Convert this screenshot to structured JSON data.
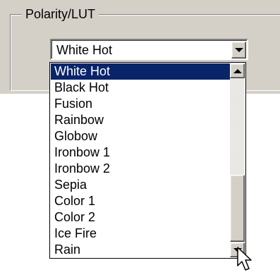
{
  "groupbox": {
    "title": "Polarity/LUT"
  },
  "combo": {
    "selected_value": "White Hot"
  },
  "dropdown": {
    "items": [
      {
        "label": "White Hot",
        "selected": true
      },
      {
        "label": "Black Hot",
        "selected": false
      },
      {
        "label": "Fusion",
        "selected": false
      },
      {
        "label": "Rainbow",
        "selected": false
      },
      {
        "label": "Globow",
        "selected": false
      },
      {
        "label": "Ironbow 1",
        "selected": false
      },
      {
        "label": "Ironbow 2",
        "selected": false
      },
      {
        "label": "Sepia",
        "selected": false
      },
      {
        "label": "Color 1",
        "selected": false
      },
      {
        "label": "Color 2",
        "selected": false
      },
      {
        "label": "Ice Fire",
        "selected": false
      },
      {
        "label": "Rain",
        "selected": false
      }
    ]
  },
  "icons": {
    "combo_button": "chevron-down-icon",
    "scroll_up": "scroll-up-arrow-icon",
    "scroll_down": "scroll-down-arrow-icon",
    "pointer": "mouse-pointer-icon"
  },
  "colors": {
    "panel_bg": "#d4d0c8",
    "selection_bg": "#0a246a",
    "selection_text": "#ffffff"
  }
}
